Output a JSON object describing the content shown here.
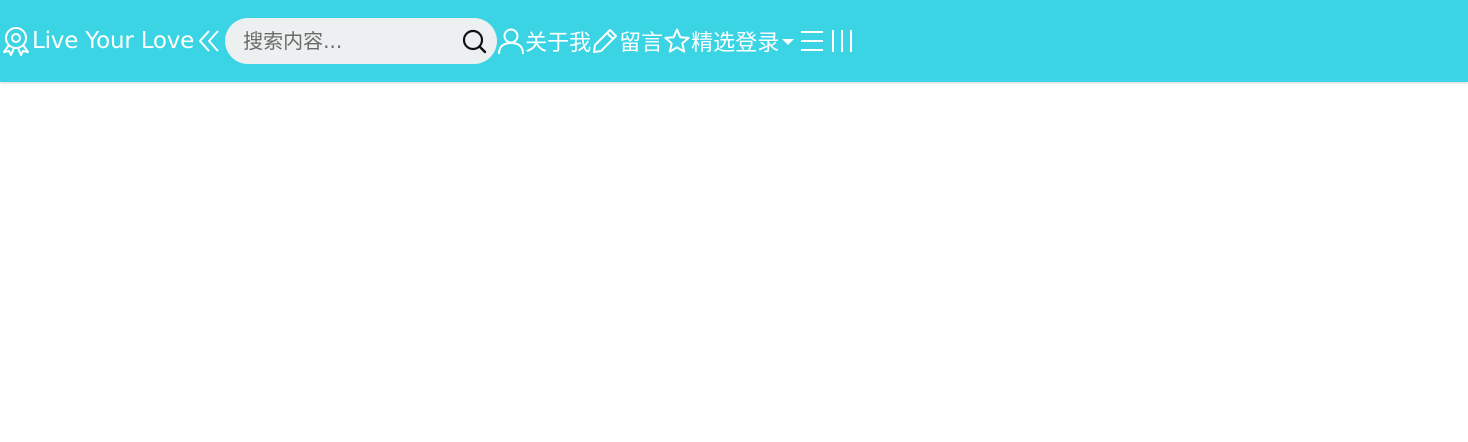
{
  "navbar": {
    "brand_text": "Live Your Love",
    "search": {
      "placeholder": "搜索内容..."
    },
    "items": [
      {
        "label": "关于我",
        "icon": "user-icon"
      },
      {
        "label": "留言",
        "icon": "pencil-icon"
      },
      {
        "label": "精选",
        "icon": "star-icon"
      },
      {
        "label": "登录",
        "icon": "caret-down-icon"
      }
    ],
    "background_color": "#3ad4e5",
    "text_color": "#ffffff",
    "search_background": "#edf0f1"
  }
}
